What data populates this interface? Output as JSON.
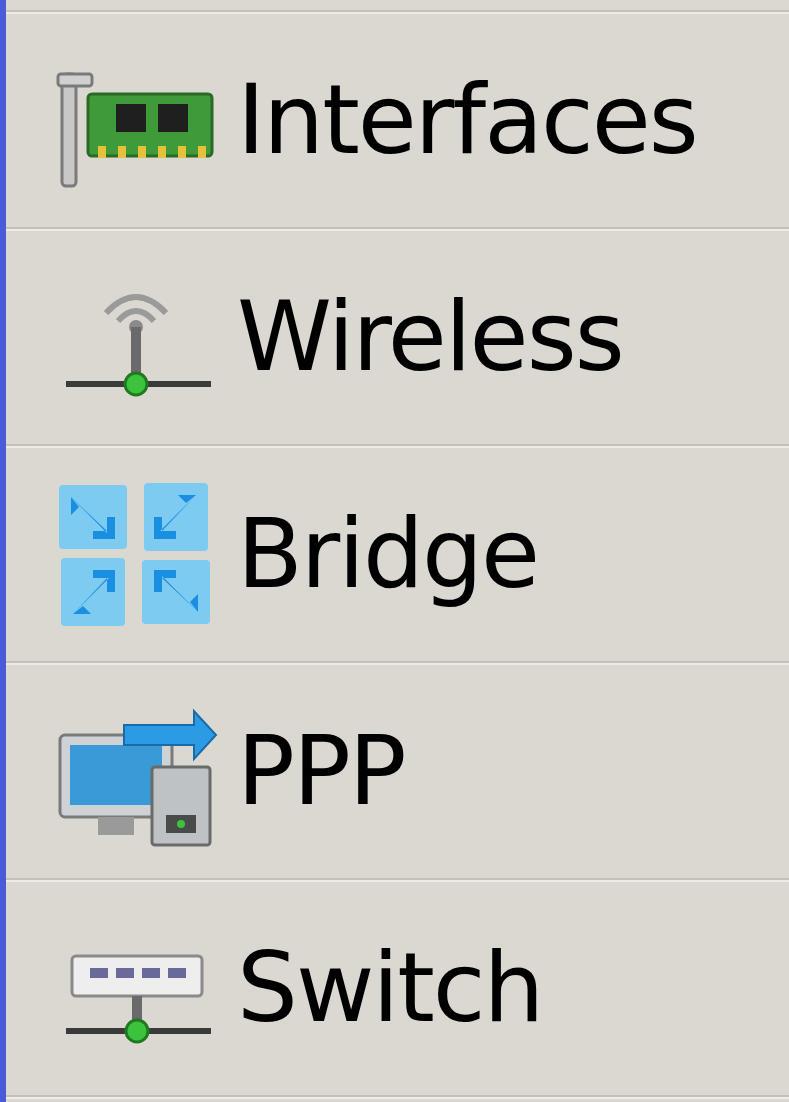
{
  "menu": {
    "items": [
      {
        "label": "Interfaces",
        "kind": "interfaces"
      },
      {
        "label": "Wireless",
        "kind": "wireless"
      },
      {
        "label": "Bridge",
        "kind": "bridge"
      },
      {
        "label": "PPP",
        "kind": "ppp"
      },
      {
        "label": "Switch",
        "kind": "switch"
      }
    ]
  }
}
